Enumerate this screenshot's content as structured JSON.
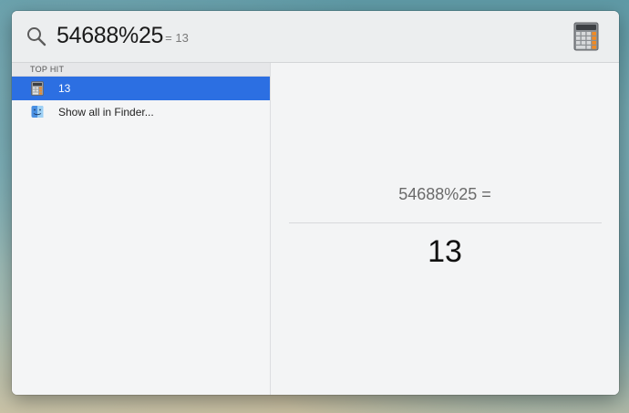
{
  "search": {
    "query": "54688%25",
    "inline_result": "= 13",
    "app_icon": "calculator-icon"
  },
  "results": {
    "section_label": "TOP HIT",
    "items": [
      {
        "label": "13",
        "icon": "calculator-icon",
        "selected": true
      },
      {
        "label": "Show all in Finder...",
        "icon": "finder-icon",
        "selected": false
      }
    ]
  },
  "preview": {
    "expression": "54688%25 =",
    "answer": "13"
  },
  "colors": {
    "selection": "#2c6fe2",
    "calculator_orange": "#f08a24"
  }
}
